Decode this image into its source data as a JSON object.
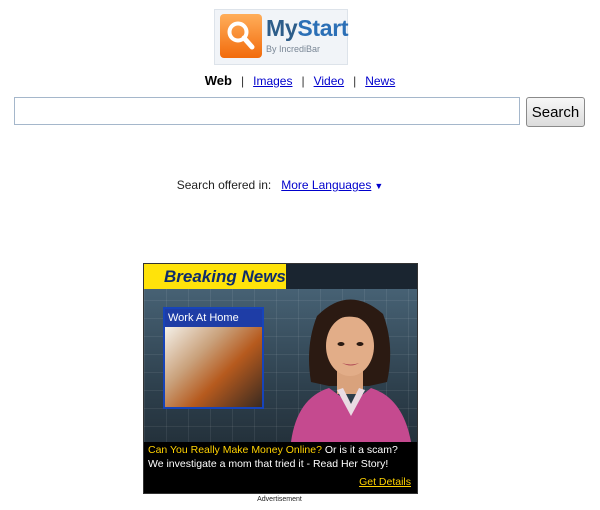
{
  "logo": {
    "title_part1": "My",
    "title_part2": "Start",
    "subtitle": "By IncrediBar",
    "icon": "magnifier-icon"
  },
  "nav": {
    "active": "Web",
    "links": [
      "Images",
      "Video",
      "News"
    ],
    "separator": "|"
  },
  "search": {
    "value": "",
    "button_label": "Search"
  },
  "languages": {
    "prefix": "Search offered in:",
    "link": "More Languages",
    "arrow": "▼"
  },
  "ad": {
    "banner": "Breaking News",
    "inset_label": "Work At Home",
    "caption_highlight": "Can You Really Make Money Online?",
    "caption_text": " Or is it a scam? We investigate a mom that tried it - Read Her Story!",
    "cta": "Get Details",
    "label": "Advertisement"
  },
  "colors": {
    "link": "#0000cc",
    "brand_orange": "#f26b0c",
    "brand_blue": "#2b6fb6",
    "ad_yellow": "#ffe30a"
  }
}
